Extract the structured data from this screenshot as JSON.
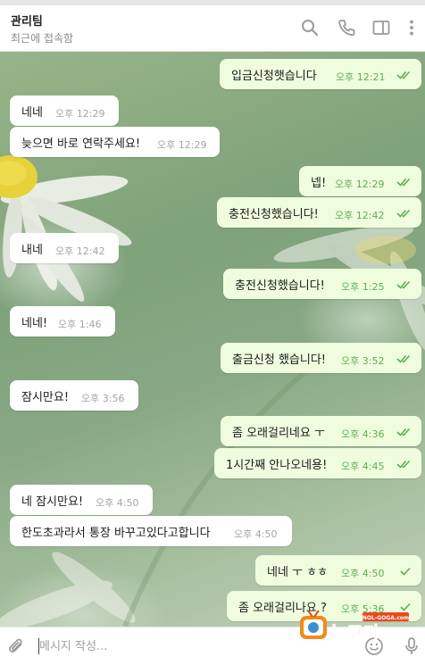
{
  "header": {
    "title": "관리팀",
    "subtitle": "최근에 접속함"
  },
  "colors": {
    "outgoing_bubble": "#effdde",
    "incoming_bubble": "#ffffff",
    "read_check": "#5cae53",
    "time_in": "#a4a4a4"
  },
  "icons": {
    "search": "search-icon",
    "call": "phone-icon",
    "sidebar": "sidebar-toggle-icon",
    "more": "more-vertical-icon",
    "attach": "paperclip-icon",
    "emoji": "emoji-icon",
    "mic": "microphone-icon"
  },
  "messages": [
    {
      "text": "입금신청햇습니다",
      "time": "오후 12:21",
      "dir": "out",
      "read": "double"
    },
    {
      "text": "네네",
      "time": "오후 12:29",
      "dir": "in"
    },
    {
      "text": "늦으면 바로 연락주세요!",
      "time": "오후 12:29",
      "dir": "in"
    },
    {
      "text": "넵!",
      "time": "오후 12:29",
      "dir": "out",
      "read": "double"
    },
    {
      "text": "충전신청했습니다!",
      "time": "오후 12:42",
      "dir": "out",
      "read": "double"
    },
    {
      "text": "내네",
      "time": "오후 12:42",
      "dir": "in"
    },
    {
      "text": "충전신청했습니다!",
      "time": "오후 1:25",
      "dir": "out",
      "read": "double"
    },
    {
      "text": "네네!",
      "time": "오후 1:46",
      "dir": "in"
    },
    {
      "text": "출금신청 했습니다!",
      "time": "오후 3:52",
      "dir": "out",
      "read": "double"
    },
    {
      "text": "잠시만요!",
      "time": "오후 3:56",
      "dir": "in"
    },
    {
      "text": "좀 오래걸리네요 ㅜ",
      "time": "오후 4:36",
      "dir": "out",
      "read": "double"
    },
    {
      "text": "1시간째 안나오네용!",
      "time": "오후 4:45",
      "dir": "out",
      "read": "double"
    },
    {
      "text": "네 잠시만요!",
      "time": "오후 4:50",
      "dir": "in"
    },
    {
      "text": "한도초과라서 통장 바꾸고있다고합니다",
      "time": "오후 4:50",
      "dir": "in"
    },
    {
      "text": "네네 ㅜ ㅎㅎ",
      "time": "오후 4:50",
      "dir": "out",
      "read": "single"
    },
    {
      "text": "좀 오래걸리나요 ?",
      "time": "오후 5:36",
      "dir": "out",
      "read": "single"
    }
  ],
  "composer": {
    "placeholder": "메시지 작성..."
  },
  "watermark": {
    "main": "놀고가",
    "sub": "NOL-GOGA.com"
  }
}
